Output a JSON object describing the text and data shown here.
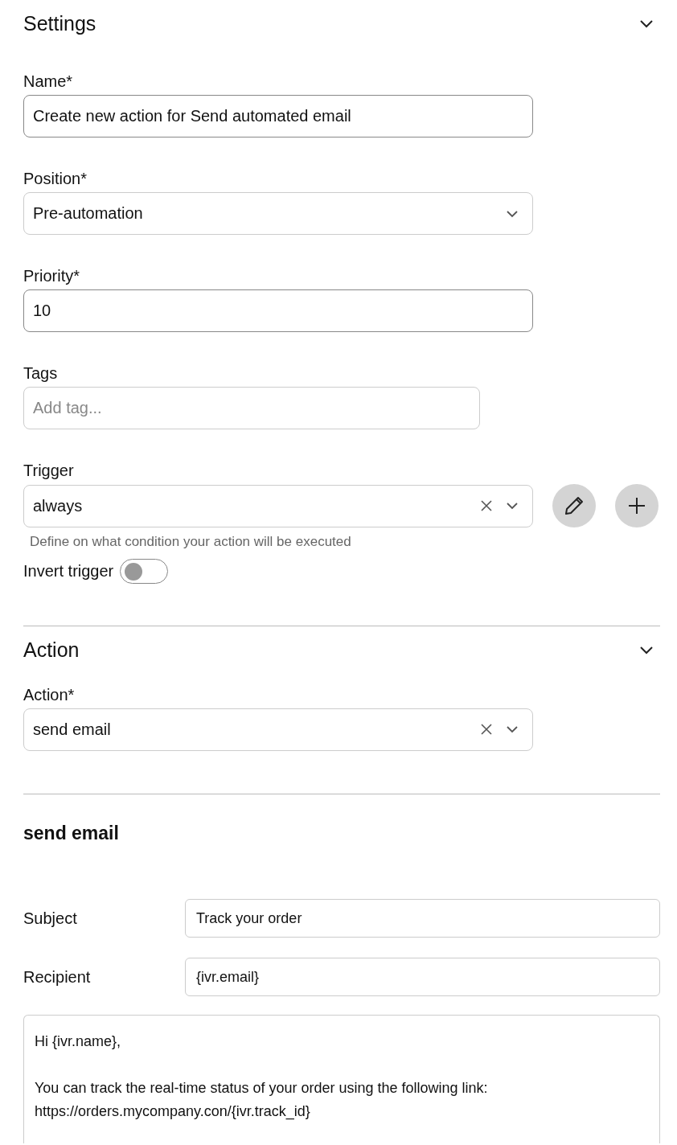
{
  "settings": {
    "title": "Settings",
    "expanded": true,
    "fields": [
      {
        "kind": "text",
        "label": "Name*",
        "value": "Create new action for Send automated email"
      },
      {
        "kind": "select",
        "label": "Position*",
        "value": "Pre-automation",
        "clearable": false
      },
      {
        "kind": "text",
        "label": "Priority*",
        "value": "10"
      },
      {
        "kind": "tags",
        "label": "Tags",
        "placeholder": "Add tag..."
      },
      {
        "kind": "trigger",
        "label": "Trigger",
        "value": "always",
        "clearable": true,
        "help": "Define on what condition your action will be executed"
      }
    ],
    "invert_trigger": {
      "label": "Invert trigger",
      "on": false
    }
  },
  "action": {
    "title": "Action",
    "expanded": true,
    "fields": [
      {
        "kind": "select",
        "label": "Action*",
        "value": "send email",
        "clearable": true
      }
    ]
  },
  "send_email": {
    "title": "send email",
    "rows": [
      {
        "label": "Subject",
        "value": "Track your order"
      },
      {
        "label": "Recipient",
        "value": "{ivr.email}"
      }
    ],
    "body": "Hi {ivr.name},\n\nYou can track the real-time status of your order using the following link:\nhttps://orders.mycompany.con/{ivr.track_id}"
  }
}
